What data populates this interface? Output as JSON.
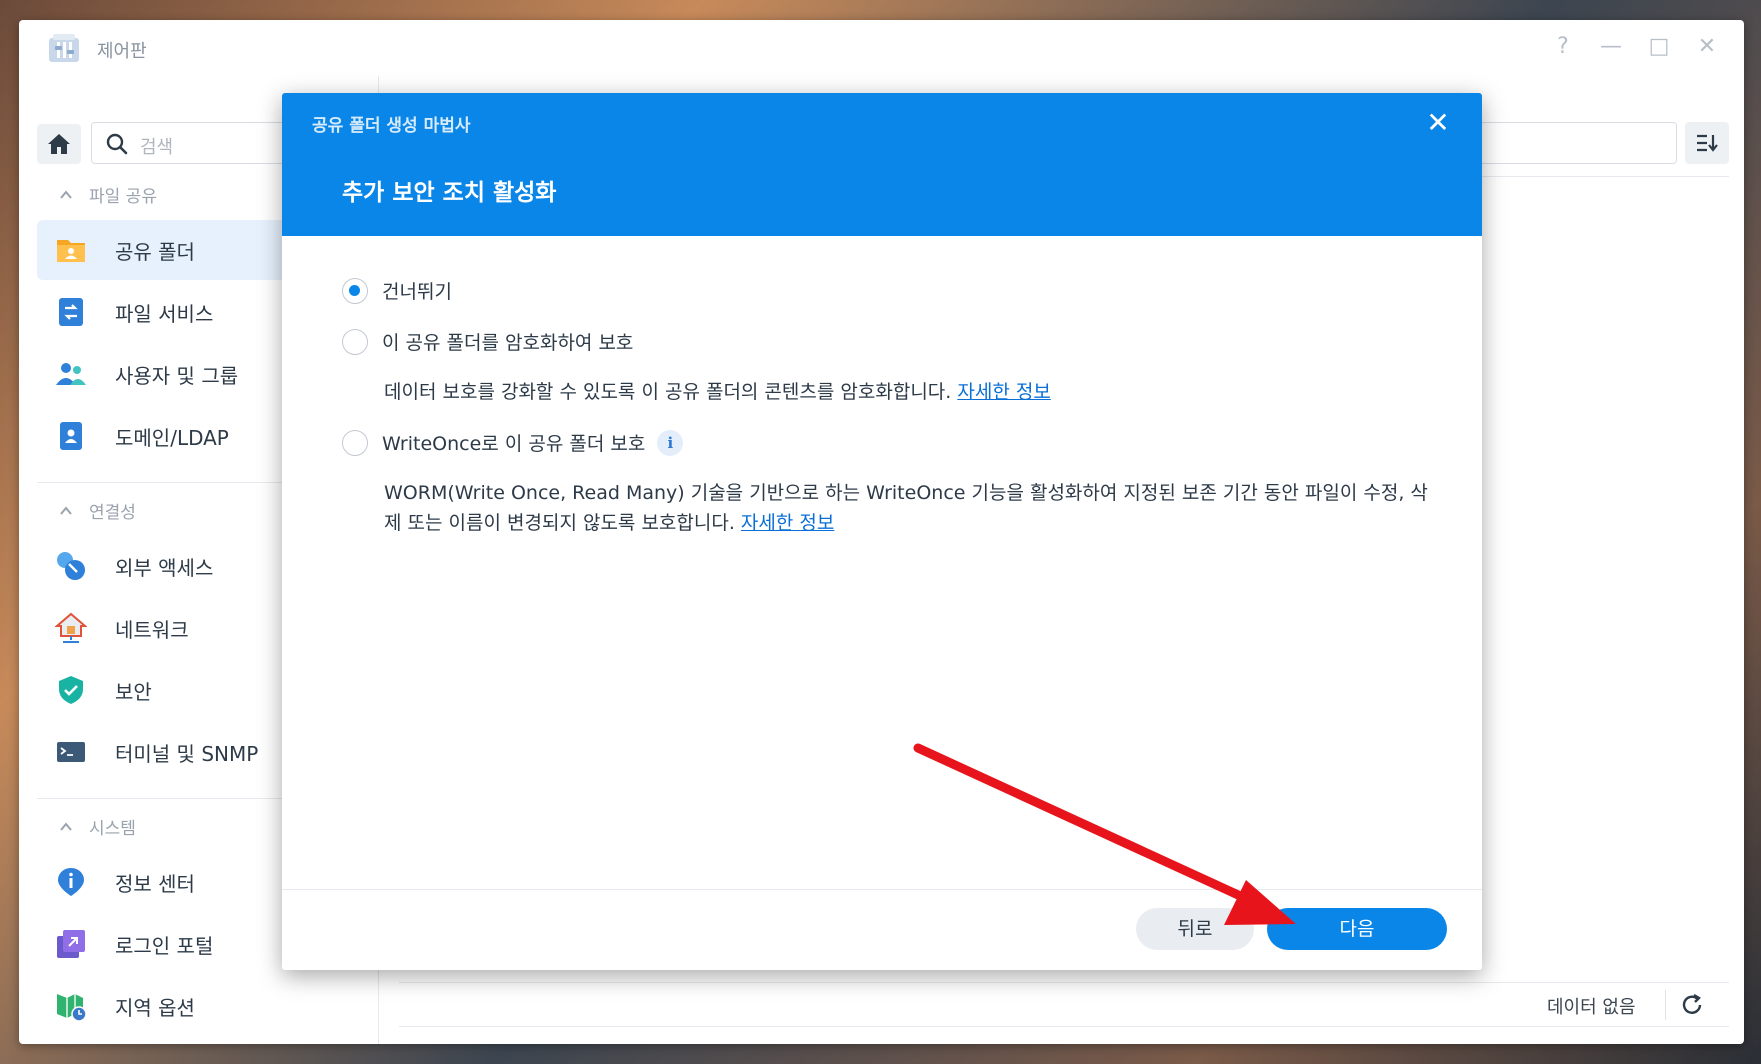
{
  "window": {
    "title": "제어판",
    "controls": {
      "help": "?",
      "minimize": "—",
      "maximize": "□",
      "close": "✕"
    }
  },
  "sidebar": {
    "search_placeholder": "검색",
    "sections": [
      {
        "label": "파일 공유",
        "items": [
          {
            "label": "공유 폴더",
            "icon": "shared-folder-icon"
          },
          {
            "label": "파일 서비스",
            "icon": "file-services-icon"
          },
          {
            "label": "사용자 및 그룹",
            "icon": "users-icon"
          },
          {
            "label": "도메인/LDAP",
            "icon": "domain-icon"
          }
        ]
      },
      {
        "label": "연결성",
        "items": [
          {
            "label": "외부 액세스",
            "icon": "external-access-icon"
          },
          {
            "label": "네트워크",
            "icon": "network-icon"
          },
          {
            "label": "보안",
            "icon": "security-shield-icon"
          },
          {
            "label": "터미널 및 SNMP",
            "icon": "terminal-icon"
          }
        ]
      },
      {
        "label": "시스템",
        "items": [
          {
            "label": "정보 센터",
            "icon": "info-center-icon"
          },
          {
            "label": "로그인 포털",
            "icon": "login-portal-icon"
          },
          {
            "label": "지역 옵션",
            "icon": "regional-options-icon"
          }
        ]
      }
    ]
  },
  "main": {
    "no_data": "데이터 없음"
  },
  "dialog": {
    "subtitle": "공유 폴더 생성 마법사",
    "title": "추가 보안 조치 활성화",
    "close": "✕",
    "options": [
      {
        "label": "건너뛰기",
        "checked": true
      },
      {
        "label": "이 공유 폴더를 암호화하여 보호",
        "checked": false,
        "description": "데이터 보호를 강화할 수 있도록 이 공유 폴더의 콘텐츠를 암호화합니다. ",
        "link": "자세한 정보"
      },
      {
        "label": "WriteOnce로 이 공유 폴더 보호",
        "checked": false,
        "info": "i",
        "description": "WORM(Write Once, Read Many) 기술을 기반으로 하는 WriteOnce 기능을 활성화하여 지정된 보존 기간 동안 파일이 수정, 삭제 또는 이름이 변경되지 않도록 보호합니다. ",
        "link": "자세한 정보"
      }
    ],
    "back_label": "뒤로",
    "next_label": "다음"
  },
  "colors": {
    "accent": "#0a86e8",
    "annotation_arrow": "#e8141b"
  }
}
